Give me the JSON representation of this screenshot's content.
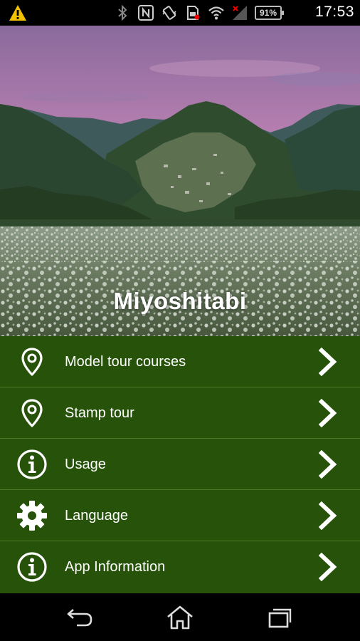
{
  "status_bar": {
    "time": "17:53",
    "battery": "91%",
    "icons": [
      "warning-icon",
      "bluetooth-icon",
      "nfc-icon",
      "vibrate-icon",
      "sim-icon",
      "wifi-icon",
      "signal-icon",
      "battery-icon"
    ]
  },
  "app": {
    "title": "Miyoshitabi"
  },
  "menu": {
    "items": [
      {
        "label": "Model tour courses",
        "icon": "location-pin-icon"
      },
      {
        "label": "Stamp tour",
        "icon": "location-pin-icon"
      },
      {
        "label": "Usage",
        "icon": "info-icon"
      },
      {
        "label": "Language",
        "icon": "gear-icon"
      },
      {
        "label": "App Information",
        "icon": "info-icon"
      }
    ],
    "background_color": "#265209",
    "divider_color": "#4a7a2a"
  },
  "nav_bar": {
    "buttons": [
      "back-icon",
      "home-icon",
      "recent-apps-icon"
    ]
  }
}
